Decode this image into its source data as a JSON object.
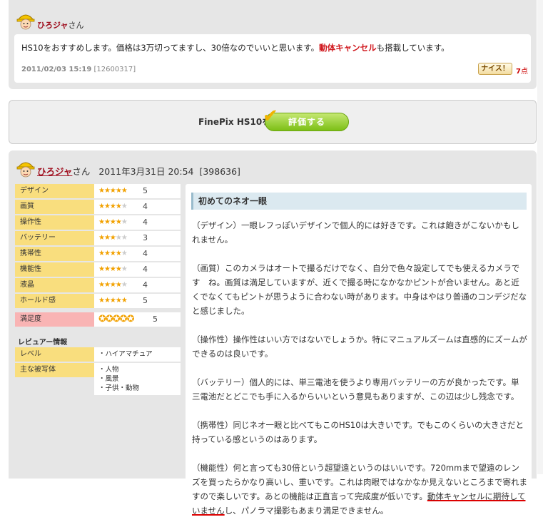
{
  "prev_review": {
    "username": "ひろジャ",
    "suffix": "さん",
    "text_before": "HS10をおすすめします。価格は3万切ってますし、30倍なのでいいと思います。",
    "highlight": "動体キャンセル",
    "text_after": "も搭載しています。",
    "datetime": "2011/02/03 15:19",
    "id": "[12600317]",
    "nice_label": "ナイス！",
    "nice_count": "7",
    "nice_unit": "点"
  },
  "rate_bar": {
    "product": "FinePix HS10を",
    "button": "評価する"
  },
  "review": {
    "username": "ひろジャ",
    "suffix": "さん",
    "datetime": "2011年3月31日 20:54",
    "id": "[398636]",
    "ratings": [
      {
        "label": "デザイン",
        "stars": 5,
        "value": "5"
      },
      {
        "label": "画質",
        "stars": 4,
        "value": "4"
      },
      {
        "label": "操作性",
        "stars": 4,
        "value": "4"
      },
      {
        "label": "バッテリー",
        "stars": 3,
        "value": "3"
      },
      {
        "label": "携帯性",
        "stars": 4,
        "value": "4"
      },
      {
        "label": "機能性",
        "stars": 4,
        "value": "4"
      },
      {
        "label": "液晶",
        "stars": 4,
        "value": "4"
      },
      {
        "label": "ホールド感",
        "stars": 5,
        "value": "5"
      }
    ],
    "satisfaction": {
      "label": "満足度",
      "stars": 5,
      "value": "5"
    },
    "reviewer_info_title": "レビュアー情報",
    "level_label": "レベル",
    "level_value": "・ハイアマチュア",
    "subject_label": "主な被写体",
    "subjects": [
      "・人物",
      "・風景",
      "・子供・動物"
    ],
    "title": "初めてのネオ一眼",
    "paragraphs": [
      "（デザイン）一眼レフっぽいデザインで個人的には好きです。これは飽きがこないかもしれません。",
      "（画質）このカメラはオートで撮るだけでなく、自分で色々設定してでも使えるカメラです　ね。画質は満足していますが、近くで撮る時になかなかピントが合いません。あと近くでなくてもピントが思うように合わない時があります。中身はやはり普通のコンデジだなと感じました。",
      "（操作性）操作性はいい方ではないでしょうか。特にマニュアルズームは直感的にズームができるのは良いです。",
      "（バッテリー）個人的には、単三電池を使うより専用バッテリーの方が良かったです。単三電池だとどこでも手に入るからいいという意見もありますが、この辺は少し残念です。",
      "（携帯性）同じネオ一眼と比べてもこのHS10は大きいです。でもこのくらいの大きさだと持っている感というのはあります。"
    ],
    "last_para_before": "（機能性）何と言っても30倍という超望遠というのはいいです。720mmまで望遠のレンズを買ったらかなり高いし、重いです。これは肉眼ではなかなか見えないところまで寄れますので楽しいです。あとの機能は正直言って完成度が低いです。",
    "last_para_underline": "動体キャンセルに期待していません",
    "last_para_after": "し、パノラマ撮影もあまり満足できません。"
  }
}
